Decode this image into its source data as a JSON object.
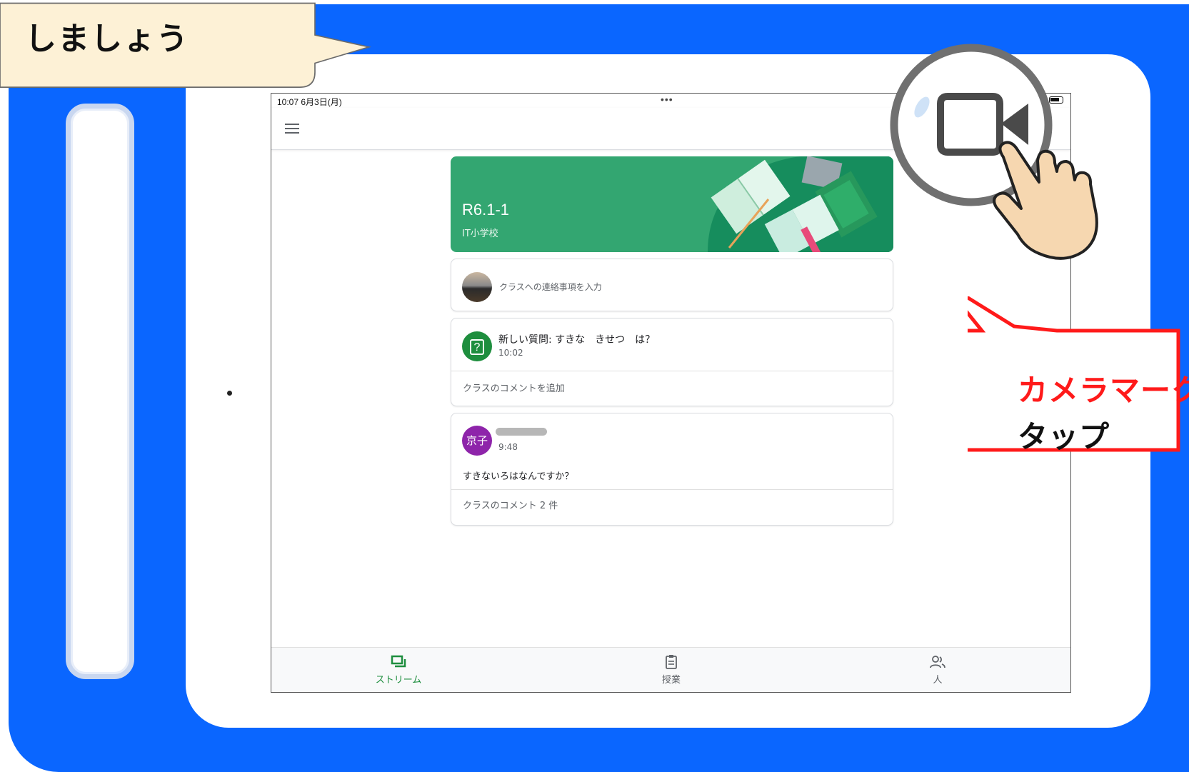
{
  "tutorial": {
    "top_callout": "しましょう",
    "red_callout_line1": "カメラマーク",
    "red_callout_line2": "タップ"
  },
  "status_bar": {
    "time": "10:07 6月3日(月)",
    "dots": "•••"
  },
  "class_banner": {
    "title": "R6.1-1",
    "subtitle": "IT小学校"
  },
  "announce": {
    "placeholder": "クラスへの連絡事項を入力"
  },
  "posts": [
    {
      "title": "新しい質問: すきな　きせつ　は？",
      "time": "10:02",
      "comment_link": "クラスのコメントを追加"
    },
    {
      "avatar": "京子",
      "time": "9:48",
      "body": "すきないろはなんですか？",
      "comment_link": "クラスのコメント 2 件"
    }
  ],
  "bottom_nav": [
    {
      "label": "ストリーム",
      "icon": "stream-icon",
      "active": true
    },
    {
      "label": "授業",
      "icon": "classwork-icon",
      "active": false
    },
    {
      "label": "人",
      "icon": "people-icon",
      "active": false
    }
  ],
  "colors": {
    "frame_blue": "#0a66ff",
    "banner_green": "#33a671",
    "accent_green": "#1e8e3e",
    "avatar_purple": "#8e24aa",
    "callout_red": "#ff1a1a",
    "callout_fill": "#fdf1d6"
  },
  "icons": [
    "menu-icon",
    "question-icon",
    "video-camera-icon",
    "pointing-hand-icon",
    "battery-icon"
  ]
}
